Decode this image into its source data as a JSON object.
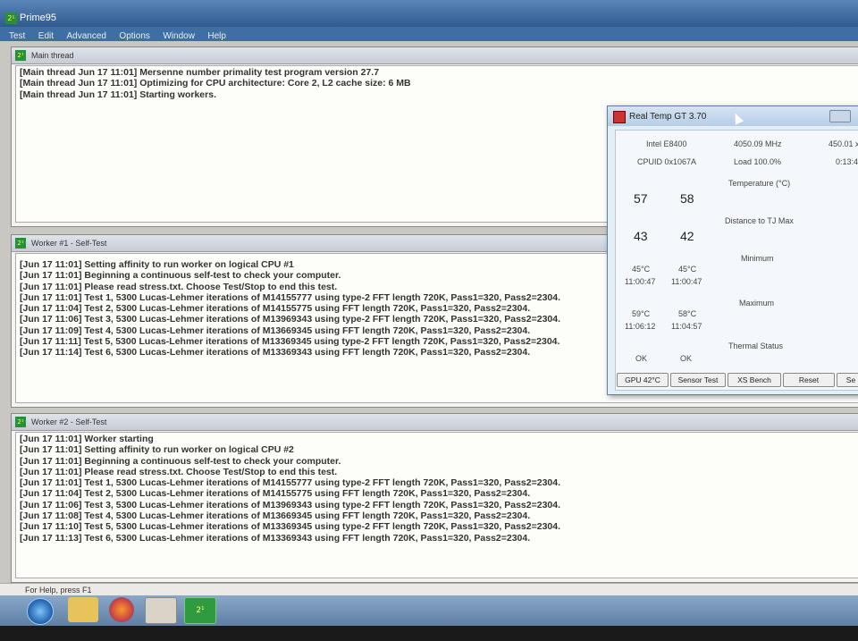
{
  "app": {
    "title": "Prime95",
    "icon_glyph": "2¹"
  },
  "menu": [
    "Test",
    "Edit",
    "Advanced",
    "Options",
    "Window",
    "Help"
  ],
  "main_thread": {
    "title": "Main thread",
    "lines": [
      "[Main thread Jun 17 11:01] Mersenne number primality test program version 27.7",
      "[Main thread Jun 17 11:01] Optimizing for CPU architecture: Core 2, L2 cache size: 6 MB",
      "[Main thread Jun 17 11:01] Starting workers."
    ]
  },
  "worker1": {
    "title": "Worker #1 - Self-Test",
    "lines": [
      "[Jun 17 11:01] Setting affinity to run worker on logical CPU #1",
      "[Jun 17 11:01] Beginning a continuous self-test to check your computer.",
      "[Jun 17 11:01] Please read stress.txt.  Choose Test/Stop to end this test.",
      "[Jun 17 11:01] Test 1, 5300 Lucas-Lehmer iterations of M14155777 using type-2 FFT length 720K, Pass1=320, Pass2=2304.",
      "[Jun 17 11:04] Test 2, 5300 Lucas-Lehmer iterations of M14155775 using FFT length 720K, Pass1=320, Pass2=2304.",
      "[Jun 17 11:06] Test 3, 5300 Lucas-Lehmer iterations of M13969343 using type-2 FFT length 720K, Pass1=320, Pass2=2304.",
      "[Jun 17 11:09] Test 4, 5300 Lucas-Lehmer iterations of M13669345 using FFT length 720K, Pass1=320, Pass2=2304.",
      "[Jun 17 11:11] Test 5, 5300 Lucas-Lehmer iterations of M13369345 using type-2 FFT length 720K, Pass1=320, Pass2=2304.",
      "[Jun 17 11:14] Test 6, 5300 Lucas-Lehmer iterations of M13369343 using FFT length 720K, Pass1=320, Pass2=2304."
    ]
  },
  "worker2": {
    "title": "Worker #2 - Self-Test",
    "lines": [
      "[Jun 17 11:01] Worker starting",
      "[Jun 17 11:01] Setting affinity to run worker on logical CPU #2",
      "[Jun 17 11:01] Beginning a continuous self-test to check your computer.",
      "[Jun 17 11:01] Please read stress.txt.  Choose Test/Stop to end this test.",
      "[Jun 17 11:01] Test 1, 5300 Lucas-Lehmer iterations of M14155777 using type-2 FFT length 720K, Pass1=320, Pass2=2304.",
      "[Jun 17 11:04] Test 2, 5300 Lucas-Lehmer iterations of M14155775 using FFT length 720K, Pass1=320, Pass2=2304.",
      "[Jun 17 11:06] Test 3, 5300 Lucas-Lehmer iterations of M13969343 using type-2 FFT length 720K, Pass1=320, Pass2=2304.",
      "[Jun 17 11:08] Test 4, 5300 Lucas-Lehmer iterations of M13669345 using FFT length 720K, Pass1=320, Pass2=2304.",
      "[Jun 17 11:10] Test 5, 5300 Lucas-Lehmer iterations of M13369345 using type-2 FFT length 720K, Pass1=320, Pass2=2304.",
      "[Jun 17 11:13] Test 6, 5300 Lucas-Lehmer iterations of M13369343 using FFT length 720K, Pass1=320, Pass2=2304."
    ]
  },
  "realtemp": {
    "title": "Real Temp GT 3.70",
    "cpu": "Intel E8400",
    "mhz": "4050.09 MHz",
    "mult": "450.01 x",
    "cpuid": "CPUID  0x1067A",
    "load": "Load 100.0%",
    "time": "0:13:4",
    "temp_label": "Temperature (°C)",
    "temp": [
      "57",
      "58"
    ],
    "dist_label": "Distance to TJ Max",
    "dist": [
      "43",
      "42"
    ],
    "min_label": "Minimum",
    "min": [
      "45°C",
      "45°C"
    ],
    "min_time": [
      "11:00:47",
      "11:00:47"
    ],
    "max_label": "Maximum",
    "max": [
      "59°C",
      "58°C"
    ],
    "max_time": [
      "11:06:12",
      "11:04:57"
    ],
    "status_label": "Thermal Status",
    "status": [
      "OK",
      "OK"
    ],
    "buttons": [
      "GPU  42°C",
      "Sensor Test",
      "XS Bench",
      "Reset",
      "Se"
    ]
  },
  "statusbar": "For Help, press F1"
}
